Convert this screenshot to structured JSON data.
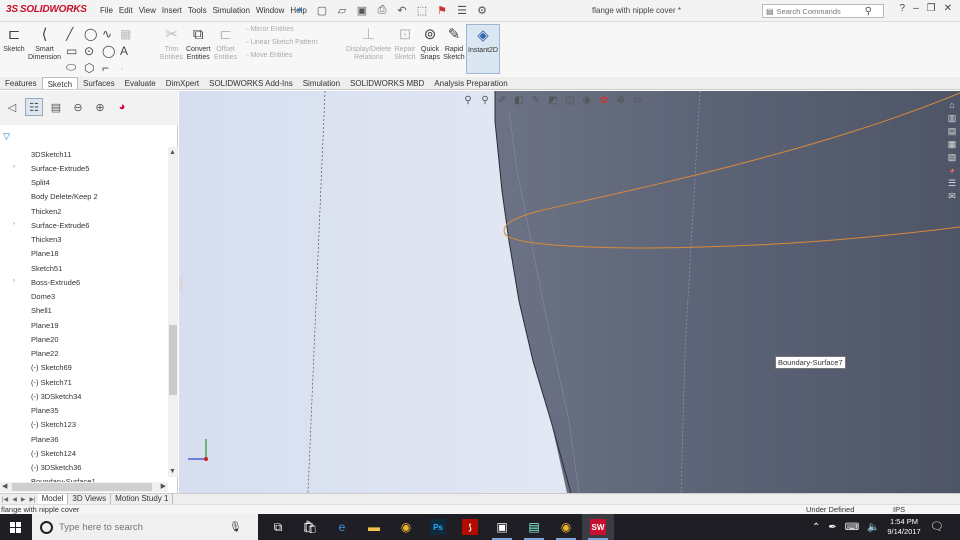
{
  "app": {
    "logo_ds": "3S",
    "logo_text": "SOLIDWORKS",
    "doc_title": "flange with nipple cover *",
    "menu": [
      "File",
      "Edit",
      "View",
      "Insert",
      "Tools",
      "Simulation",
      "Window",
      "Help"
    ],
    "search_placeholder": "Search Commands"
  },
  "ribbon": {
    "sketch": [
      "Sketch",
      ""
    ],
    "smart_dimension": [
      "Smart",
      "Dimension"
    ],
    "trim": [
      "Trim",
      "Entities"
    ],
    "convert": [
      "Convert",
      "Entities"
    ],
    "offset": [
      "Offset",
      "Entities"
    ],
    "mirror": "Mirror Entities",
    "linear_pattern": "Linear Sketch Pattern",
    "move": "Move Entities",
    "display_delete": [
      "Display/Delete",
      "Relations"
    ],
    "repair": [
      "Repair",
      "Sketch"
    ],
    "quick_snaps": [
      "Quick",
      "Snaps"
    ],
    "rapid_sketch": [
      "Rapid",
      "Sketch"
    ],
    "instant2d": "Instant2D"
  },
  "tabs": [
    "Features",
    "Sketch",
    "Surfaces",
    "Evaluate",
    "DimXpert",
    "SOLIDWORKS Add-Ins",
    "Simulation",
    "SOLIDWORKS MBD",
    "Analysis Preparation"
  ],
  "active_tab": "Sketch",
  "tree": [
    {
      "label": "3DSketch11",
      "exp": false
    },
    {
      "label": "Surface-Extrude5",
      "exp": true
    },
    {
      "label": "Split4",
      "exp": false
    },
    {
      "label": "Body Delete/Keep 2",
      "exp": false
    },
    {
      "label": "Thicken2",
      "exp": false
    },
    {
      "label": "Surface-Extrude6",
      "exp": true
    },
    {
      "label": "Thicken3",
      "exp": false
    },
    {
      "label": "Plane18",
      "exp": false
    },
    {
      "label": "Sketch51",
      "exp": false
    },
    {
      "label": "Boss-Extrude6",
      "exp": true
    },
    {
      "label": "Dome3",
      "exp": false
    },
    {
      "label": "Shell1",
      "exp": false
    },
    {
      "label": "Plane19",
      "exp": false
    },
    {
      "label": "Plane20",
      "exp": false
    },
    {
      "label": "Plane22",
      "exp": false
    },
    {
      "label": "(-) Sketch69",
      "exp": false
    },
    {
      "label": "(-) Sketch71",
      "exp": false
    },
    {
      "label": "(-) 3DSketch34",
      "exp": false
    },
    {
      "label": "Plane35",
      "exp": false
    },
    {
      "label": "(-) Sketch123",
      "exp": false
    },
    {
      "label": "Plane36",
      "exp": false
    },
    {
      "label": "(-) Sketch124",
      "exp": false
    },
    {
      "label": "(-) 3DSketch36",
      "exp": false
    },
    {
      "label": "Boundary-Surface1",
      "exp": false
    }
  ],
  "viewport": {
    "tooltip": "Boundary-Surface7",
    "colors": {
      "background_left": "#dfe6f3",
      "model_surface": "#5d6577",
      "edge_orange": "#d98a3a"
    }
  },
  "bottom_tabs": [
    "Model",
    "3D Views",
    "Motion Study 1"
  ],
  "active_bottom_tab": "Model",
  "status": {
    "left": "flange with nipple cover",
    "middle": "Under Defined",
    "units": "IPS"
  },
  "taskbar": {
    "search_placeholder": "Type here to search",
    "time": "1:54 PM",
    "date": "9/14/2017"
  }
}
